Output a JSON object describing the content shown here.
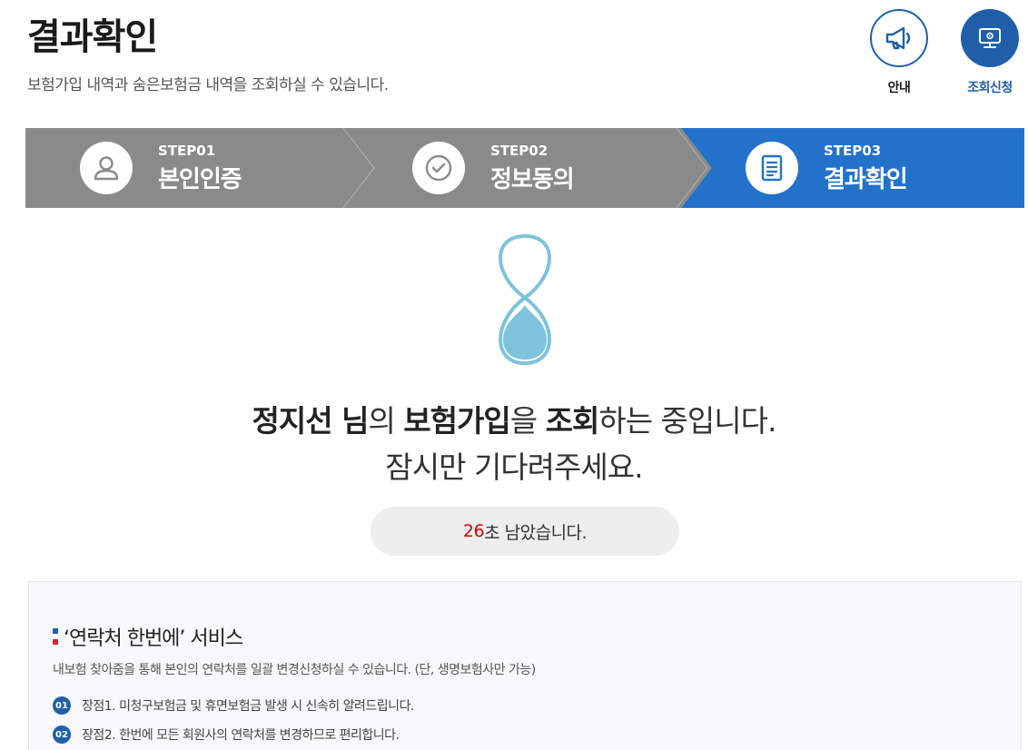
{
  "header": {
    "title": "결과확인",
    "description": "보험가입 내역과 숨은보험금 내역을 조회하실 수 있습니다."
  },
  "top_buttons": {
    "guide_label": "안내",
    "guide_icon": "megaphone-icon",
    "request_label": "조회신청",
    "request_icon": "monitor-icon"
  },
  "steps": [
    {
      "num": "STEP01",
      "name": "본인인증",
      "icon": "person-icon",
      "state": "done"
    },
    {
      "num": "STEP02",
      "name": "정보동의",
      "icon": "check-circle-icon",
      "state": "done"
    },
    {
      "num": "STEP03",
      "name": "결과확인",
      "icon": "document-icon",
      "state": "active"
    }
  ],
  "status": {
    "user_name": "정지선 님",
    "particle1": "의 ",
    "target": "보험가입",
    "particle2": "을 ",
    "action": "조회",
    "suffix": "하는 중입니다.",
    "line2": "잠시만 기다려주세요."
  },
  "timer": {
    "seconds": "26",
    "suffix": "초 남았습니다."
  },
  "service": {
    "title": "‘연락처 한번에’ 서비스",
    "description": "내보험 찾아줌을 통해 본인의 연락처를 일괄 변경신청하실 수 있습니다. (단, 생명보험사만 가능)",
    "items": [
      {
        "num": "01",
        "text": "장점1. 미청구보험금 및 휴면보험금 발생 시 신속히 알려드립니다."
      },
      {
        "num": "02",
        "text": "장점2. 한번에 모든 회원사의 연락처를 변경하므로 편리합니다."
      }
    ]
  },
  "colors": {
    "brand_blue": "#1f5fa8",
    "step_active": "#2272c9",
    "step_inactive": "#8a8a8a",
    "timer_red": "#d40000",
    "hourglass": "#7ec3db"
  }
}
